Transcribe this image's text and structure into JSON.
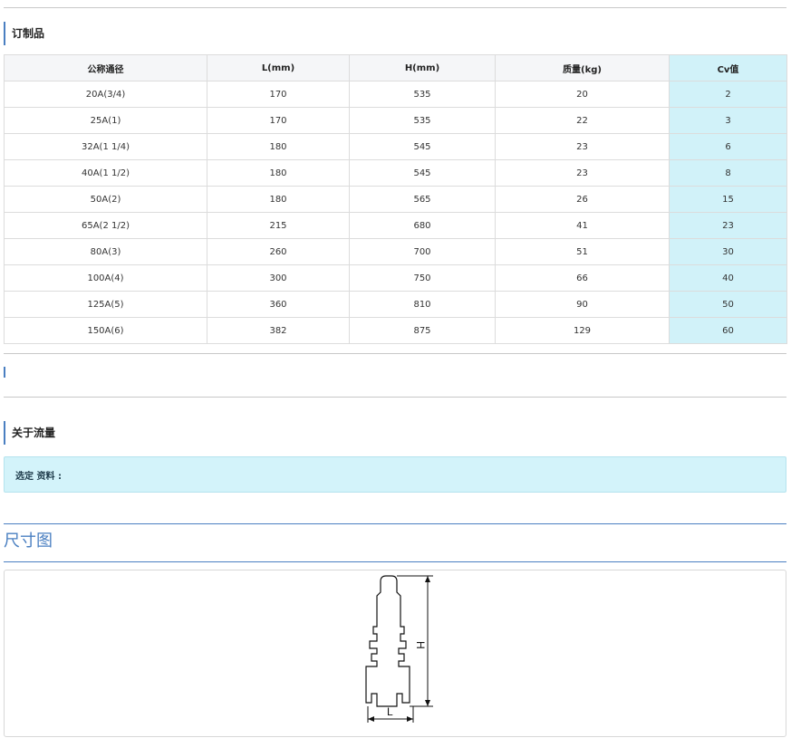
{
  "custom_section": {
    "title": "订制品"
  },
  "table": {
    "headers": [
      "公称通径",
      "L(mm)",
      "H(mm)",
      "质量(kg)",
      "Cv值"
    ],
    "rows": [
      [
        "20A(3/4)",
        "170",
        "535",
        "20",
        "2"
      ],
      [
        "25A(1)",
        "170",
        "535",
        "22",
        "3"
      ],
      [
        "32A(1 1/4)",
        "180",
        "545",
        "23",
        "6"
      ],
      [
        "40A(1 1/2)",
        "180",
        "545",
        "23",
        "8"
      ],
      [
        "50A(2)",
        "180",
        "565",
        "26",
        "15"
      ],
      [
        "65A(2 1/2)",
        "215",
        "680",
        "41",
        "23"
      ],
      [
        "80A(3)",
        "260",
        "700",
        "51",
        "30"
      ],
      [
        "100A(4)",
        "300",
        "750",
        "66",
        "40"
      ],
      [
        "125A(5)",
        "360",
        "810",
        "90",
        "50"
      ],
      [
        "150A(6)",
        "382",
        "875",
        "129",
        "60"
      ]
    ]
  },
  "flow_section": {
    "title": "关于流量",
    "info_label": "选定 资料 :"
  },
  "dimension_section": {
    "title": "尺寸图",
    "label_h": "H",
    "label_l": "L"
  },
  "colors": {
    "accent": "#4a7fc1",
    "cv_highlight": "#d1f2f9",
    "info_bg": "#d3f3fa"
  }
}
